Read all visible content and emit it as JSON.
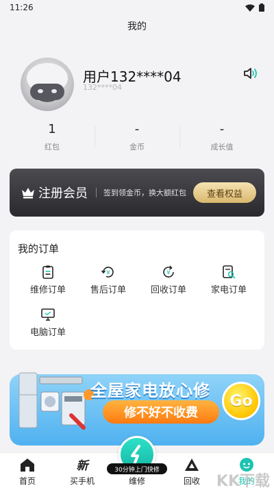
{
  "status_bar": {
    "time": "11:26"
  },
  "page": {
    "title": "我的"
  },
  "profile": {
    "username": "用户132****04",
    "user_id": "132****04"
  },
  "stats": [
    {
      "value": "1",
      "label": "红包"
    },
    {
      "value": "-",
      "label": "金币"
    },
    {
      "value": "-",
      "label": "成长值"
    }
  ],
  "vip": {
    "title": "注册会员",
    "desc": "签到领金币，换大额红包",
    "button": "查看权益"
  },
  "orders": {
    "title": "我的订单",
    "items": [
      {
        "label": "维修订单",
        "icon": "clipboard-icon"
      },
      {
        "label": "售后订单",
        "icon": "refund-icon"
      },
      {
        "label": "回收订单",
        "icon": "recycle-icon"
      },
      {
        "label": "家电订单",
        "icon": "appliance-order-icon"
      },
      {
        "label": "电脑订单",
        "icon": "computer-icon"
      }
    ]
  },
  "banner": {
    "title": "全屋家电放心修",
    "pill": "修不好不收费",
    "go": "Go"
  },
  "tabs": [
    {
      "label": "首页",
      "icon": "home-icon"
    },
    {
      "label": "买手机",
      "icon": "new-phone-icon"
    },
    {
      "label": "维修",
      "icon": "repair-icon"
    },
    {
      "label": "回收",
      "icon": "recycle-triangle-icon"
    },
    {
      "label": "我的",
      "icon": "me-icon"
    }
  ],
  "fab": {
    "tag": "30分钟上门快修"
  },
  "watermark": "KK下载",
  "colors": {
    "accent": "#1fc3b0",
    "vip_button": "#d9b86e",
    "banner_blue": "#4fb1f0"
  }
}
